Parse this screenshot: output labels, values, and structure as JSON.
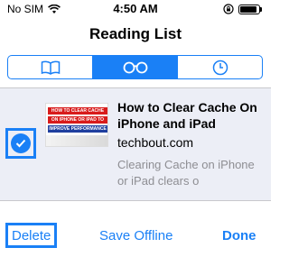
{
  "status_bar": {
    "carrier": "No SIM",
    "time": "4:50 AM"
  },
  "title": "Reading List",
  "tabs": [
    {
      "icon": "book-icon",
      "active": false
    },
    {
      "icon": "glasses-icon",
      "active": true
    },
    {
      "icon": "clock-icon",
      "active": false
    }
  ],
  "item": {
    "thumbnail_text": [
      "HOW TO CLEAR CACHE",
      "ON IPHONE OR IPAD TO",
      "IMPROVE PERFORMANCE"
    ],
    "title": "How to Clear Cache On iPhone and iPad",
    "domain": "techbout.com",
    "snippet": "Clearing Cache on iPhone or iPad clears o",
    "selected": true
  },
  "toolbar": {
    "delete_label": "Delete",
    "save_offline_label": "Save Offline",
    "done_label": "Done"
  },
  "colors": {
    "accent": "#1a80f6",
    "row_selected_bg": "#eceef6",
    "snippet_gray": "#8e8e93"
  }
}
